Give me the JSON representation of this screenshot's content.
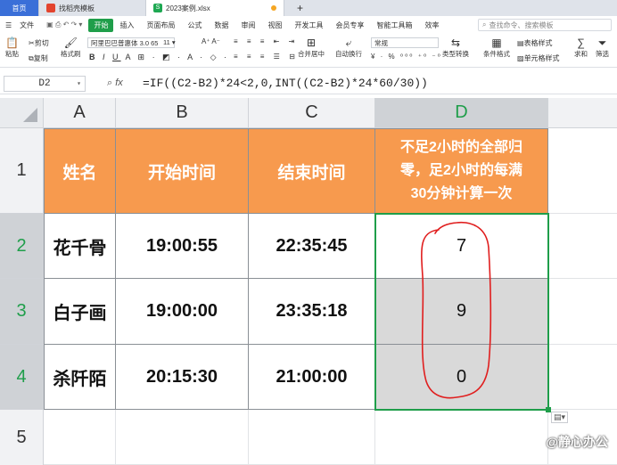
{
  "tabs": [
    {
      "label": "首页"
    },
    {
      "label": "找稻壳模板"
    },
    {
      "label": "2023案例.xlsx"
    }
  ],
  "menu": [
    "文件",
    "开始",
    "插入",
    "页面布局",
    "公式",
    "数据",
    "审阅",
    "视图",
    "开发工具",
    "会员专享",
    "智能工具箱",
    "效率"
  ],
  "search_placeholder": "查找命令、搜索模板",
  "ribbon": {
    "cut": "剪切",
    "paste": "粘贴",
    "copy": "复制",
    "format_painter": "格式刷",
    "font_name": "阿里巴巴普惠体 3.0 65",
    "font_size": "11",
    "merge": "合并居中",
    "wrap": "自动换行",
    "number_format": "常规",
    "type_convert": "类型转换",
    "conditional": "条件格式",
    "table_style": "表格样式",
    "cell_style": "单元格样式",
    "sum": "求和",
    "filter": "筛选"
  },
  "formula_bar": {
    "cell_ref": "D2",
    "fx": "fx",
    "formula": "=IF((C2-B2)*24<2,0,INT((C2-B2)*24*60/30))"
  },
  "columns": [
    "A",
    "B",
    "C",
    "D"
  ],
  "rows": [
    "1",
    "2",
    "3",
    "4",
    "5"
  ],
  "header": {
    "name": "姓名",
    "start": "开始时间",
    "end": "结束时间",
    "rule_line1": "不足2小时的全部归",
    "rule_line2": "零，足2小时的每满",
    "rule_line3": "30分钟计算一次"
  },
  "table": [
    {
      "name": "花千骨",
      "start": "19:00:55",
      "end": "22:35:45",
      "result": "7"
    },
    {
      "name": "白子画",
      "start": "19:00:00",
      "end": "23:35:18",
      "result": "9"
    },
    {
      "name": "杀阡陌",
      "start": "20:15:30",
      "end": "21:00:00",
      "result": "0"
    }
  ],
  "watermark": "@静心办公",
  "colors": {
    "accent_green": "#1f9e4a",
    "header_orange": "#f79a4e",
    "annotation_red": "#e01e1e"
  }
}
